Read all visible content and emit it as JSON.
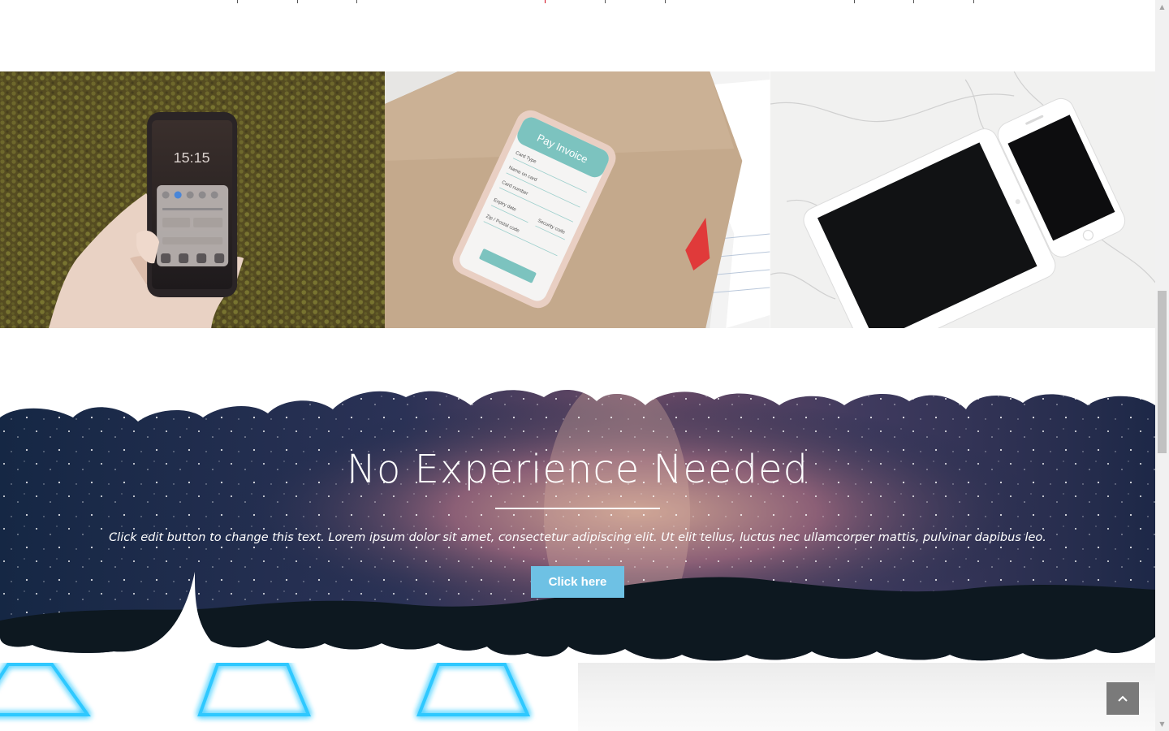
{
  "gallery": {
    "items": [
      {
        "alt": "hand-holding-phone",
        "clock": "15:15"
      },
      {
        "alt": "phone-pay-invoice",
        "screen_title": "Pay Invoice",
        "fields": [
          "Card Type",
          "Name on card",
          "Card number",
          "Expiry date",
          "Security code",
          "Zip / Postal code"
        ]
      },
      {
        "alt": "tablet-and-phone-on-marble"
      }
    ]
  },
  "cta": {
    "title": "No Experience Needed",
    "text": "Click edit button to change this text. Lorem ipsum dolor sit amet, consectetur adipiscing elit. Ut elit tellus, luctus nec ullamcorper mattis, pulvinar dapibus leo.",
    "button_label": "Click here"
  },
  "colors": {
    "accent": "#6ec1e4",
    "back_to_top": "#7a7a7a",
    "night_sky": "#1b2a4a"
  },
  "icons": {
    "back_to_top": "chevron-up-icon",
    "scroll_up": "scroll-up-arrow",
    "scroll_down": "scroll-down-arrow"
  }
}
